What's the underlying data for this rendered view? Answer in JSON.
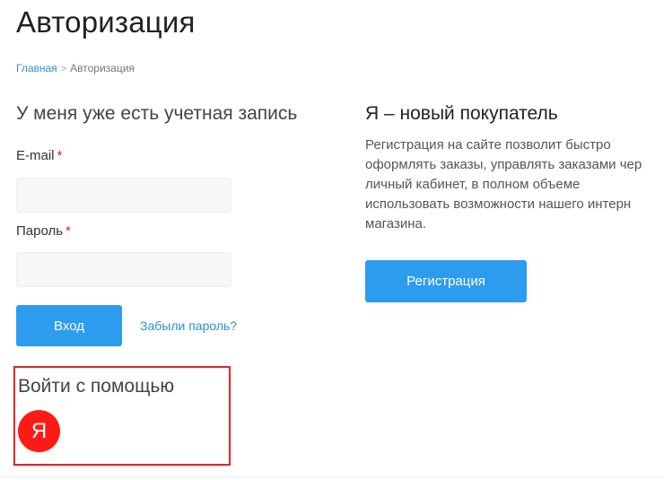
{
  "page": {
    "title": "Авторизация"
  },
  "breadcrumb": {
    "home": "Главная",
    "separator": ">",
    "current": "Авторизация"
  },
  "login": {
    "title": "У меня уже есть учетная запись",
    "email_label": "E-mail",
    "password_label": "Пароль",
    "required_mark": "*",
    "email_value": "",
    "password_value": "",
    "submit_label": "Вход",
    "forgot_label": "Забыли пароль?"
  },
  "new_customer": {
    "title": "Я – новый покупатель",
    "description_lines": [
      "Регистрация на сайте позволит быстро",
      "оформлять заказы, управлять заказами чер",
      "личный кабинет, в полном объеме",
      "использовать возможности нашего интерн",
      "магазина."
    ],
    "register_label": "Регистрация"
  },
  "social": {
    "title": "Войти с помощью",
    "yandex_glyph": "Я",
    "yandex_icon": "yandex-icon",
    "highlight_color": "#e0262e"
  },
  "colors": {
    "accent": "#2d9cef",
    "link": "#2d8fd8",
    "yandex_red": "#fc1c15"
  }
}
